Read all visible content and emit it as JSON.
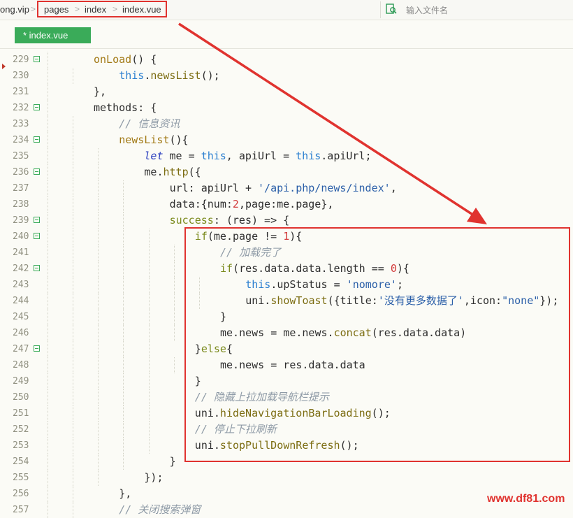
{
  "breadcrumb": {
    "site": "ong.vip",
    "items": [
      "pages",
      "index",
      "index.vue"
    ]
  },
  "search": {
    "placeholder": "输入文件名",
    "icon": "search-file-icon"
  },
  "tab": {
    "label": "* index.vue"
  },
  "code_lines": [
    {
      "n": "229",
      "fold": true,
      "indent": 2,
      "tokens": [
        [
          "fn",
          "onLoad"
        ],
        [
          "plain",
          "() {"
        ]
      ]
    },
    {
      "n": "230",
      "fold": false,
      "indent": 3,
      "tokens": [
        [
          "this",
          "this"
        ],
        [
          "plain",
          "."
        ],
        [
          "method",
          "newsList"
        ],
        [
          "plain",
          "();"
        ]
      ]
    },
    {
      "n": "231",
      "fold": false,
      "indent": 2,
      "tokens": [
        [
          "plain",
          "},"
        ]
      ]
    },
    {
      "n": "232",
      "fold": true,
      "indent": 2,
      "tokens": [
        [
          "plain",
          "methods: {"
        ]
      ]
    },
    {
      "n": "233",
      "fold": false,
      "indent": 3,
      "tokens": [
        [
          "cm",
          "// 信息资讯"
        ]
      ]
    },
    {
      "n": "234",
      "fold": true,
      "indent": 3,
      "tokens": [
        [
          "fn",
          "newsList"
        ],
        [
          "plain",
          "(){"
        ]
      ]
    },
    {
      "n": "235",
      "fold": false,
      "indent": 4,
      "tokens": [
        [
          "italic",
          "let"
        ],
        [
          "plain",
          " me = "
        ],
        [
          "this",
          "this"
        ],
        [
          "plain",
          ", apiUrl = "
        ],
        [
          "this",
          "this"
        ],
        [
          "plain",
          ".apiUrl;"
        ]
      ]
    },
    {
      "n": "236",
      "fold": true,
      "indent": 4,
      "tokens": [
        [
          "plain",
          "me."
        ],
        [
          "method",
          "http"
        ],
        [
          "plain",
          "({"
        ]
      ]
    },
    {
      "n": "237",
      "fold": false,
      "indent": 5,
      "tokens": [
        [
          "plain",
          "url: apiUrl + "
        ],
        [
          "str",
          "'/api.php/news/index'"
        ],
        [
          "plain",
          ","
        ]
      ]
    },
    {
      "n": "238",
      "fold": false,
      "indent": 5,
      "tokens": [
        [
          "plain",
          "data:{num:"
        ],
        [
          "num",
          "2"
        ],
        [
          "plain",
          ",page:me.page},"
        ]
      ]
    },
    {
      "n": "239",
      "fold": true,
      "indent": 5,
      "tokens": [
        [
          "kw",
          "success"
        ],
        [
          "plain",
          ": (res) => {"
        ]
      ]
    },
    {
      "n": "240",
      "fold": true,
      "indent": 6,
      "tokens": [
        [
          "kw",
          "if"
        ],
        [
          "plain",
          "(me.page != "
        ],
        [
          "num",
          "1"
        ],
        [
          "plain",
          "){"
        ]
      ]
    },
    {
      "n": "241",
      "fold": false,
      "indent": 7,
      "tokens": [
        [
          "cm",
          "// 加载完了"
        ]
      ]
    },
    {
      "n": "242",
      "fold": true,
      "indent": 7,
      "tokens": [
        [
          "kw",
          "if"
        ],
        [
          "plain",
          "(res.data.data.length == "
        ],
        [
          "num",
          "0"
        ],
        [
          "plain",
          "){"
        ]
      ]
    },
    {
      "n": "243",
      "fold": false,
      "indent": 8,
      "tokens": [
        [
          "this",
          "this"
        ],
        [
          "plain",
          ".upStatus = "
        ],
        [
          "str",
          "'nomore'"
        ],
        [
          "plain",
          ";"
        ]
      ]
    },
    {
      "n": "244",
      "fold": false,
      "indent": 8,
      "tokens": [
        [
          "plain",
          "uni."
        ],
        [
          "method",
          "showToast"
        ],
        [
          "plain",
          "({title:"
        ],
        [
          "str",
          "'没有更多数据了'"
        ],
        [
          "plain",
          ",icon:"
        ],
        [
          "str",
          "\"none\""
        ],
        [
          "plain",
          "});"
        ]
      ]
    },
    {
      "n": "245",
      "fold": false,
      "indent": 7,
      "tokens": [
        [
          "plain",
          "}"
        ]
      ]
    },
    {
      "n": "246",
      "fold": false,
      "indent": 7,
      "tokens": [
        [
          "plain",
          "me.news = me.news."
        ],
        [
          "method",
          "concat"
        ],
        [
          "plain",
          "(res.data.data)"
        ]
      ]
    },
    {
      "n": "247",
      "fold": true,
      "indent": 6,
      "tokens": [
        [
          "plain",
          "}"
        ],
        [
          "kw",
          "else"
        ],
        [
          "plain",
          "{"
        ]
      ]
    },
    {
      "n": "248",
      "fold": false,
      "indent": 7,
      "tokens": [
        [
          "plain",
          "me.news = res.data.data"
        ]
      ]
    },
    {
      "n": "249",
      "fold": false,
      "indent": 6,
      "tokens": [
        [
          "plain",
          "}"
        ]
      ]
    },
    {
      "n": "250",
      "fold": false,
      "indent": 6,
      "tokens": [
        [
          "cm",
          "// 隐藏上拉加载导航栏提示"
        ]
      ]
    },
    {
      "n": "251",
      "fold": false,
      "indent": 6,
      "tokens": [
        [
          "plain",
          "uni."
        ],
        [
          "method",
          "hideNavigationBarLoading"
        ],
        [
          "plain",
          "();"
        ]
      ]
    },
    {
      "n": "252",
      "fold": false,
      "indent": 6,
      "tokens": [
        [
          "cm",
          "// 停止下拉刷新"
        ]
      ]
    },
    {
      "n": "253",
      "fold": false,
      "indent": 6,
      "tokens": [
        [
          "plain",
          "uni."
        ],
        [
          "method",
          "stopPullDownRefresh"
        ],
        [
          "plain",
          "();"
        ]
      ]
    },
    {
      "n": "254",
      "fold": false,
      "indent": 5,
      "tokens": [
        [
          "plain",
          "}"
        ]
      ]
    },
    {
      "n": "255",
      "fold": false,
      "indent": 4,
      "tokens": [
        [
          "plain",
          "});"
        ]
      ]
    },
    {
      "n": "256",
      "fold": false,
      "indent": 3,
      "tokens": [
        [
          "plain",
          "},"
        ]
      ]
    },
    {
      "n": "257",
      "fold": false,
      "indent": 3,
      "tokens": [
        [
          "cm",
          "// 关闭搜索弹窗"
        ]
      ]
    }
  ],
  "watermark": "www.df81.com",
  "colors": {
    "annotation_red": "#e0332f",
    "tab_green": "#3aab59"
  }
}
